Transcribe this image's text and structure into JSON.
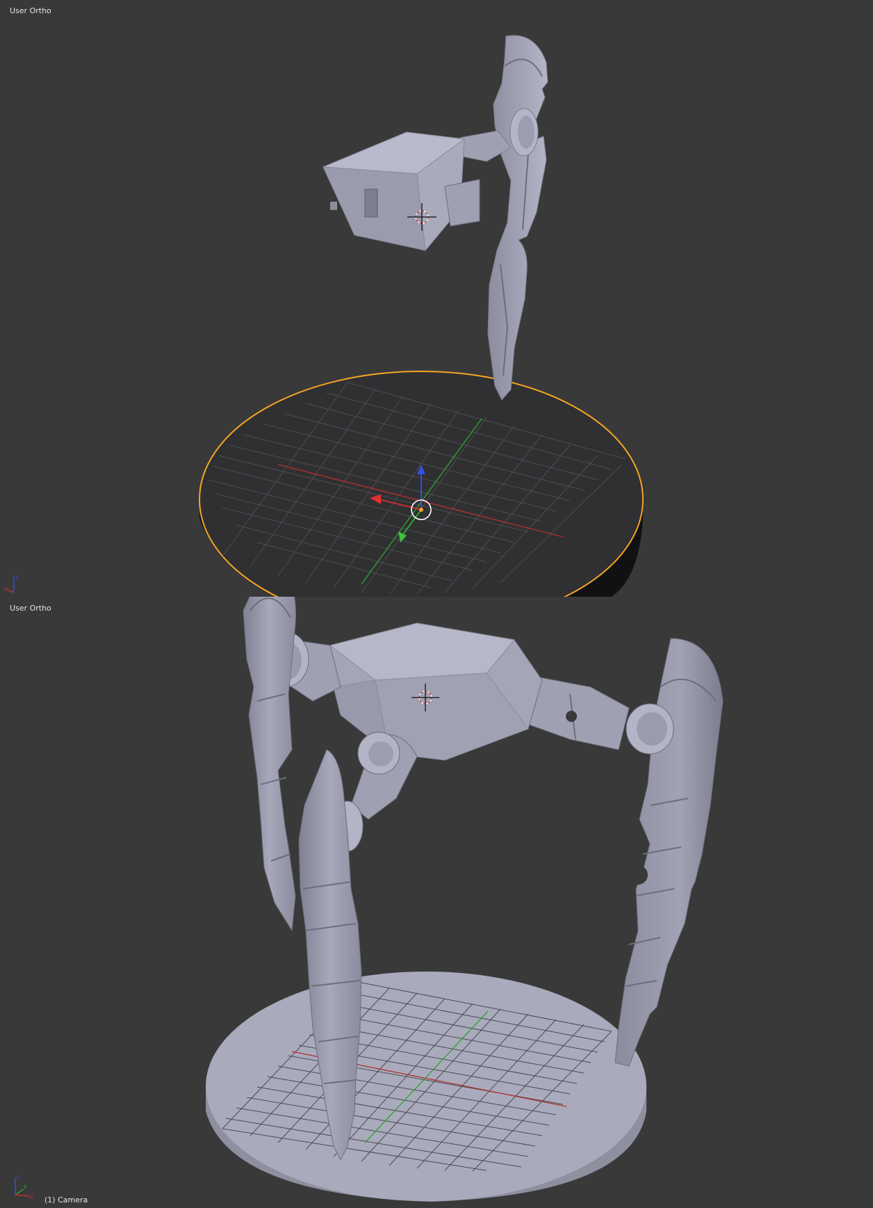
{
  "top_viewport": {
    "view_label": "User Ortho",
    "axis_widget": {
      "z_label": "z"
    }
  },
  "bottom_viewport": {
    "view_label": "User Ortho",
    "object_label": "(1) Camera",
    "axis_widget": {
      "z_label": "z",
      "y_label": "y",
      "x_label": "x"
    }
  },
  "colors": {
    "background": "#393939",
    "mesh": "#a3a5b8",
    "selection_outline": "#f5a623",
    "grid": "#555555",
    "x_axis": "#b03030",
    "y_axis": "#30a030",
    "z_axis": "#3050e0"
  },
  "icons": [
    "3d-cursor-icon",
    "transform-gizmo-icon",
    "axis-orientation-icon"
  ]
}
